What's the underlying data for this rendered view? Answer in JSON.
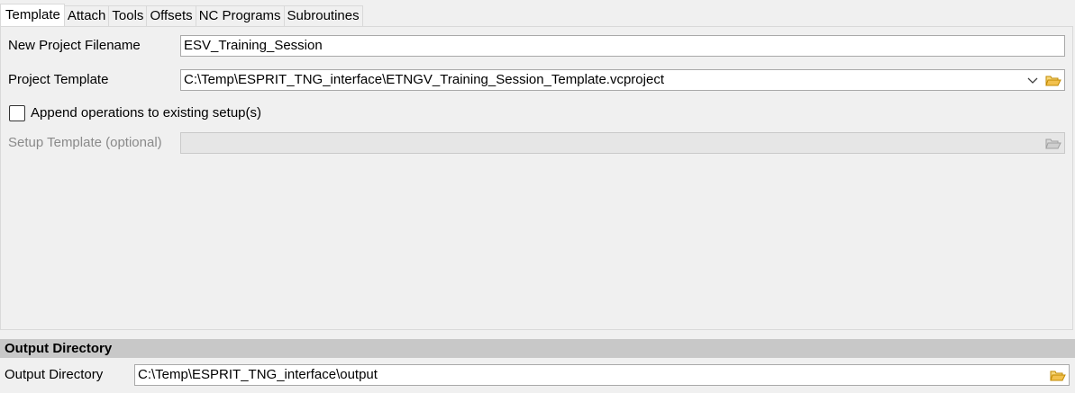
{
  "tabs": [
    {
      "label": "Template",
      "active": true
    },
    {
      "label": "Attach",
      "active": false
    },
    {
      "label": "Tools",
      "active": false
    },
    {
      "label": "Offsets",
      "active": false
    },
    {
      "label": "NC Programs",
      "active": false
    },
    {
      "label": "Subroutines",
      "active": false
    }
  ],
  "template": {
    "new_project_filename": {
      "label": "New Project Filename",
      "value": "ESV_Training_Session"
    },
    "project_template": {
      "label": "Project Template",
      "value": "C:\\Temp\\ESPRIT_TNG_interface\\ETNGV_Training_Session_Template.vcproject"
    },
    "append_operations": {
      "label": "Append operations to existing setup(s)",
      "checked": false
    },
    "setup_template": {
      "label": "Setup Template (optional)",
      "value": "",
      "disabled": true
    }
  },
  "output": {
    "section_title": "Output Directory",
    "label": "Output Directory",
    "value": "C:\\Temp\\ESPRIT_TNG_interface\\output"
  },
  "icons": {
    "folder": "folder-open-icon",
    "chevron": "chevron-down-icon"
  },
  "colors": {
    "folder_yellow": "#f2c14e",
    "folder_outline": "#c28a00",
    "section_header_bg": "#c8c8c8",
    "panel_bg": "#f0f0f0"
  }
}
